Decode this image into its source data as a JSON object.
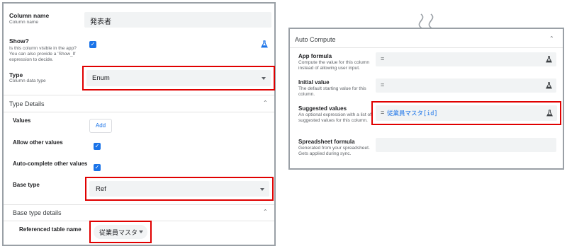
{
  "left_panel": {
    "column_name": {
      "label": "Column name",
      "desc": "Column name",
      "value": "発表者"
    },
    "show": {
      "label": "Show?",
      "desc": "Is this column visible in the app? You can also provide a 'Show_If expression to decide.",
      "checked": true
    },
    "type": {
      "label": "Type",
      "desc": "Column data type",
      "value": "Enum"
    },
    "type_details": {
      "title": "Type Details",
      "values": {
        "label": "Values",
        "button": "Add"
      },
      "allow_other": {
        "label": "Allow other values",
        "checked": true
      },
      "autocomplete": {
        "label": "Auto-complete other values",
        "checked": true
      },
      "base_type": {
        "label": "Base type",
        "value": "Ref"
      }
    },
    "base_type_details": {
      "title": "Base type details",
      "referenced_table": {
        "label": "Referenced table name",
        "value": "従業員マスタ"
      }
    }
  },
  "right_panel": {
    "title": "Auto Compute",
    "app_formula": {
      "label": "App formula",
      "desc": "Compute the value for this column instead of allowing user input.",
      "value": "="
    },
    "initial_value": {
      "label": "Initial value",
      "desc": "The default starting value for this column.",
      "value": "="
    },
    "suggested_values": {
      "label": "Suggested values",
      "desc": "An optional expression with a list of suggested values for this column.",
      "eq": "=",
      "expr": "従業員マスタ[id]"
    },
    "spreadsheet_formula": {
      "label": "Spreadsheet formula",
      "desc": "Generated from your spreadsheet. Gets applied during sync.",
      "value": ""
    }
  },
  "colors": {
    "highlight": "#e00000",
    "accent": "#1a73e8",
    "field_bg": "#f1f3f4"
  },
  "icons": [
    "flask-icon",
    "checkbox-checked-icon",
    "chevron-up-icon",
    "dropdown-caret-icon",
    "break-mark-icon"
  ]
}
